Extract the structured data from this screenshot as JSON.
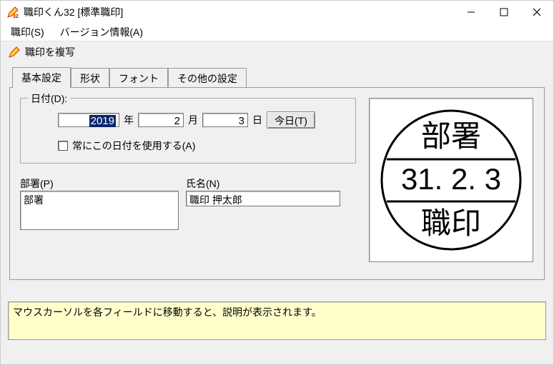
{
  "titlebar": {
    "text": "職印くん32 [標準職印]"
  },
  "menubar": {
    "items": [
      "職印(S)",
      "バージョン情報(A)"
    ]
  },
  "client": {
    "section_label": "職印を複写"
  },
  "tabs": {
    "items": [
      "基本設定",
      "形状",
      "フォント",
      "その他の設定"
    ],
    "active_index": 0
  },
  "date_group": {
    "legend": "日付(D):",
    "year_value": "2019",
    "year_unit": "年",
    "month_value": "2",
    "month_unit": "月",
    "day_value": "3",
    "day_unit": "日",
    "today_btn": "今日(T)",
    "always_use_label": "常にこの日付を使用する(A)"
  },
  "dept": {
    "label": "部署(P)",
    "value": "部署"
  },
  "name": {
    "label": "氏名(N)",
    "value": "職印 押太郎"
  },
  "stamp": {
    "top_text": "部署",
    "middle_text": "31. 2. 3",
    "bottom_text": "職印"
  },
  "status": {
    "text": "マウスカーソルを各フィールドに移動すると、説明が表示されます。"
  }
}
